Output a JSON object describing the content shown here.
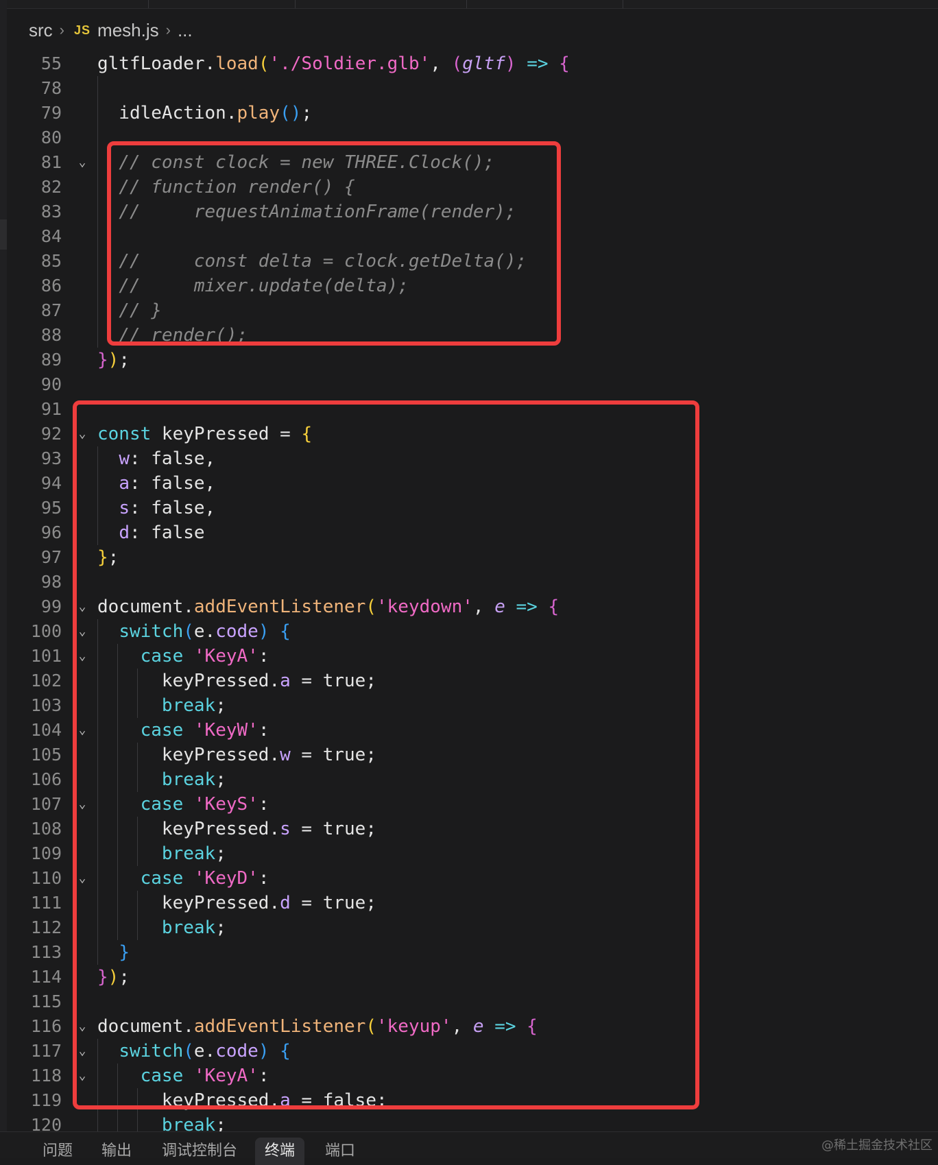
{
  "breadcrumb": {
    "folder": "src",
    "file_badge": "JS",
    "file": "mesh.js",
    "more": "..."
  },
  "colors": {
    "highlight_box": "#ee3d3d",
    "background": "#1b1b1c",
    "keyword": "#5bd3e0",
    "function": "#f0b47a",
    "string": "#ef6ac5",
    "comment": "#8b8b8b"
  },
  "lines": [
    {
      "n": "55",
      "fold": false,
      "guides": 0,
      "tokens": [
        [
          "gltfLoader."
        ],
        [
          "load",
          "fn"
        ],
        [
          "(",
          "b1"
        ],
        [
          "'./Soldier.glb'",
          "str"
        ],
        [
          ", "
        ],
        [
          "(",
          "b2"
        ],
        [
          "gltf",
          "pr"
        ],
        [
          ")",
          "b2"
        ],
        [
          " "
        ],
        [
          "=>",
          "ar"
        ],
        [
          " "
        ],
        [
          "{",
          "b2"
        ]
      ]
    },
    {
      "n": "78",
      "fold": false,
      "guides": 1,
      "tokens": []
    },
    {
      "n": "79",
      "fold": false,
      "guides": 1,
      "tokens": [
        [
          "  idleAction."
        ],
        [
          "play",
          "fn"
        ],
        [
          "(",
          "b3"
        ],
        [
          ")",
          "b3"
        ],
        [
          ";"
        ]
      ]
    },
    {
      "n": "80",
      "fold": false,
      "guides": 1,
      "tokens": []
    },
    {
      "n": "81",
      "fold": true,
      "guides": 1,
      "tokens": [
        [
          "  // const clock = new THREE.Clock();",
          "cmt"
        ]
      ]
    },
    {
      "n": "82",
      "fold": false,
      "guides": 1,
      "tokens": [
        [
          "  // function render() {",
          "cmt"
        ]
      ]
    },
    {
      "n": "83",
      "fold": false,
      "guides": 1,
      "tokens": [
        [
          "  //     requestAnimationFrame(render);",
          "cmt"
        ]
      ]
    },
    {
      "n": "84",
      "fold": false,
      "guides": 1,
      "tokens": []
    },
    {
      "n": "85",
      "fold": false,
      "guides": 1,
      "tokens": [
        [
          "  //     const delta = clock.getDelta();",
          "cmt"
        ]
      ]
    },
    {
      "n": "86",
      "fold": false,
      "guides": 1,
      "tokens": [
        [
          "  //     mixer.update(delta);",
          "cmt"
        ]
      ]
    },
    {
      "n": "87",
      "fold": false,
      "guides": 1,
      "tokens": [
        [
          "  // }",
          "cmt"
        ]
      ]
    },
    {
      "n": "88",
      "fold": false,
      "guides": 1,
      "tokens": [
        [
          "  // render();",
          "cmt"
        ]
      ]
    },
    {
      "n": "89",
      "fold": false,
      "guides": 0,
      "tokens": [
        [
          "}",
          "b2"
        ],
        [
          ")",
          "b1"
        ],
        [
          ";"
        ]
      ]
    },
    {
      "n": "90",
      "fold": false,
      "guides": 0,
      "tokens": []
    },
    {
      "n": "91",
      "fold": false,
      "guides": 0,
      "tokens": []
    },
    {
      "n": "92",
      "fold": true,
      "guides": 0,
      "tokens": [
        [
          "const",
          "kw"
        ],
        [
          " keyPressed = "
        ],
        [
          "{",
          "b1"
        ]
      ]
    },
    {
      "n": "93",
      "fold": false,
      "guides": 1,
      "tokens": [
        [
          "  "
        ],
        [
          "w",
          "prop"
        ],
        [
          ": false,"
        ]
      ]
    },
    {
      "n": "94",
      "fold": false,
      "guides": 1,
      "tokens": [
        [
          "  "
        ],
        [
          "a",
          "prop"
        ],
        [
          ": false,"
        ]
      ]
    },
    {
      "n": "95",
      "fold": false,
      "guides": 1,
      "tokens": [
        [
          "  "
        ],
        [
          "s",
          "prop"
        ],
        [
          ": false,"
        ]
      ]
    },
    {
      "n": "96",
      "fold": false,
      "guides": 1,
      "tokens": [
        [
          "  "
        ],
        [
          "d",
          "prop"
        ],
        [
          ": false"
        ]
      ]
    },
    {
      "n": "97",
      "fold": false,
      "guides": 0,
      "tokens": [
        [
          "}",
          "b1"
        ],
        [
          ";"
        ]
      ]
    },
    {
      "n": "98",
      "fold": false,
      "guides": 0,
      "tokens": []
    },
    {
      "n": "99",
      "fold": true,
      "guides": 0,
      "tokens": [
        [
          "document."
        ],
        [
          "addEventListener",
          "fn"
        ],
        [
          "(",
          "b1"
        ],
        [
          "'keydown'",
          "str"
        ],
        [
          ", "
        ],
        [
          "e",
          "pr"
        ],
        [
          " "
        ],
        [
          "=>",
          "ar"
        ],
        [
          " "
        ],
        [
          "{",
          "b2"
        ]
      ]
    },
    {
      "n": "100",
      "fold": true,
      "guides": 1,
      "tokens": [
        [
          "  "
        ],
        [
          "switch",
          "kw"
        ],
        [
          "(",
          "b3"
        ],
        [
          "e."
        ],
        [
          "code",
          "prop"
        ],
        [
          ")",
          "b3"
        ],
        [
          " "
        ],
        [
          "{",
          "b3"
        ]
      ]
    },
    {
      "n": "101",
      "fold": true,
      "guides": 2,
      "tokens": [
        [
          "    "
        ],
        [
          "case",
          "kw"
        ],
        [
          " "
        ],
        [
          "'KeyA'",
          "str"
        ],
        [
          ":"
        ]
      ]
    },
    {
      "n": "102",
      "fold": false,
      "guides": 3,
      "tokens": [
        [
          "      keyPressed."
        ],
        [
          "a",
          "prop"
        ],
        [
          " = true;"
        ]
      ]
    },
    {
      "n": "103",
      "fold": false,
      "guides": 3,
      "tokens": [
        [
          "      "
        ],
        [
          "break",
          "kw"
        ],
        [
          ";"
        ]
      ]
    },
    {
      "n": "104",
      "fold": true,
      "guides": 2,
      "tokens": [
        [
          "    "
        ],
        [
          "case",
          "kw"
        ],
        [
          " "
        ],
        [
          "'KeyW'",
          "str"
        ],
        [
          ":"
        ]
      ]
    },
    {
      "n": "105",
      "fold": false,
      "guides": 3,
      "tokens": [
        [
          "      keyPressed."
        ],
        [
          "w",
          "prop"
        ],
        [
          " = true;"
        ]
      ]
    },
    {
      "n": "106",
      "fold": false,
      "guides": 3,
      "tokens": [
        [
          "      "
        ],
        [
          "break",
          "kw"
        ],
        [
          ";"
        ]
      ]
    },
    {
      "n": "107",
      "fold": true,
      "guides": 2,
      "tokens": [
        [
          "    "
        ],
        [
          "case",
          "kw"
        ],
        [
          " "
        ],
        [
          "'KeyS'",
          "str"
        ],
        [
          ":"
        ]
      ]
    },
    {
      "n": "108",
      "fold": false,
      "guides": 3,
      "tokens": [
        [
          "      keyPressed."
        ],
        [
          "s",
          "prop"
        ],
        [
          " = true;"
        ]
      ]
    },
    {
      "n": "109",
      "fold": false,
      "guides": 3,
      "tokens": [
        [
          "      "
        ],
        [
          "break",
          "kw"
        ],
        [
          ";"
        ]
      ]
    },
    {
      "n": "110",
      "fold": true,
      "guides": 2,
      "tokens": [
        [
          "    "
        ],
        [
          "case",
          "kw"
        ],
        [
          " "
        ],
        [
          "'KeyD'",
          "str"
        ],
        [
          ":"
        ]
      ]
    },
    {
      "n": "111",
      "fold": false,
      "guides": 3,
      "tokens": [
        [
          "      keyPressed."
        ],
        [
          "d",
          "prop"
        ],
        [
          " = true;"
        ]
      ]
    },
    {
      "n": "112",
      "fold": false,
      "guides": 3,
      "tokens": [
        [
          "      "
        ],
        [
          "break",
          "kw"
        ],
        [
          ";"
        ]
      ]
    },
    {
      "n": "113",
      "fold": false,
      "guides": 1,
      "tokens": [
        [
          "  "
        ],
        [
          "}",
          "b3"
        ]
      ]
    },
    {
      "n": "114",
      "fold": false,
      "guides": 0,
      "tokens": [
        [
          "}",
          "b2"
        ],
        [
          ")",
          "b1"
        ],
        [
          ";"
        ]
      ]
    },
    {
      "n": "115",
      "fold": false,
      "guides": 0,
      "tokens": []
    },
    {
      "n": "116",
      "fold": true,
      "guides": 0,
      "tokens": [
        [
          "document."
        ],
        [
          "addEventListener",
          "fn"
        ],
        [
          "(",
          "b1"
        ],
        [
          "'keyup'",
          "str"
        ],
        [
          ", "
        ],
        [
          "e",
          "pr"
        ],
        [
          " "
        ],
        [
          "=>",
          "ar"
        ],
        [
          " "
        ],
        [
          "{",
          "b2"
        ]
      ]
    },
    {
      "n": "117",
      "fold": true,
      "guides": 1,
      "tokens": [
        [
          "  "
        ],
        [
          "switch",
          "kw"
        ],
        [
          "(",
          "b3"
        ],
        [
          "e."
        ],
        [
          "code",
          "prop"
        ],
        [
          ")",
          "b3"
        ],
        [
          " "
        ],
        [
          "{",
          "b3"
        ]
      ]
    },
    {
      "n": "118",
      "fold": true,
      "guides": 2,
      "tokens": [
        [
          "    "
        ],
        [
          "case",
          "kw"
        ],
        [
          " "
        ],
        [
          "'KeyA'",
          "str"
        ],
        [
          ":"
        ]
      ]
    },
    {
      "n": "119",
      "fold": false,
      "guides": 3,
      "tokens": [
        [
          "      keyPressed."
        ],
        [
          "a",
          "prop"
        ],
        [
          " = false;"
        ]
      ]
    },
    {
      "n": "120",
      "fold": false,
      "guides": 3,
      "tokens": [
        [
          "      "
        ],
        [
          "break",
          "kw"
        ],
        [
          ";"
        ]
      ]
    }
  ],
  "panel_tabs": [
    {
      "label": "问题",
      "active": false
    },
    {
      "label": "输出",
      "active": false
    },
    {
      "label": "调试控制台",
      "active": false
    },
    {
      "label": "终端",
      "active": true
    },
    {
      "label": "端口",
      "active": false
    }
  ],
  "watermark": "@稀土掘金技术社区"
}
